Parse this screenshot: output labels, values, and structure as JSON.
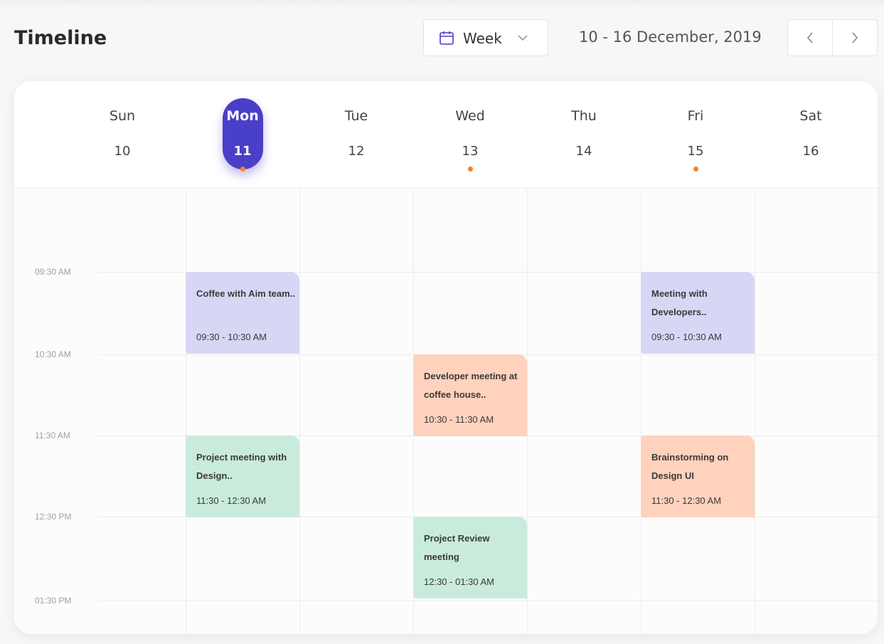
{
  "header": {
    "title": "Timeline",
    "view": "Week",
    "date_range": "10 - 16 December, 2019"
  },
  "days": [
    {
      "name": "Sun",
      "num": "10",
      "has_event": false,
      "selected": false
    },
    {
      "name": "Mon",
      "num": "11",
      "has_event": true,
      "selected": true
    },
    {
      "name": "Tue",
      "num": "12",
      "has_event": false,
      "selected": false
    },
    {
      "name": "Wed",
      "num": "13",
      "has_event": true,
      "selected": false
    },
    {
      "name": "Thu",
      "num": "14",
      "has_event": false,
      "selected": false
    },
    {
      "name": "Fri",
      "num": "15",
      "has_event": true,
      "selected": false
    },
    {
      "name": "Sat",
      "num": "16",
      "has_event": false,
      "selected": false
    }
  ],
  "times": [
    "09:30 AM",
    "10:30 AM",
    "11:30 AM",
    "12:30 PM",
    "01:30 PM"
  ],
  "events": [
    {
      "title": "Coffee with Aim team..",
      "time": "09:30 - 10:30 AM",
      "day": "Mon",
      "color": "#d8d6f5"
    },
    {
      "title": "Meeting with Developers..",
      "time": "09:30 - 10:30 AM",
      "day": "Fri",
      "color": "#d8d6f5"
    },
    {
      "title": "Developer meeting at coffee house..",
      "time": "10:30 - 11:30 AM",
      "day": "Wed",
      "color": "#fed2bd"
    },
    {
      "title": "Project meeting with Design..",
      "time": "11:30 - 12:30 AM",
      "day": "Mon",
      "color": "#c9ebdc"
    },
    {
      "title": "Brainstorming on Design UI",
      "time": "11:30 - 12:30 AM",
      "day": "Fri",
      "color": "#fed2bd"
    },
    {
      "title": "Project Review meeting",
      "time": "12:30 - 01:30 AM",
      "day": "Wed",
      "color": "#c9ebdc"
    }
  ],
  "colors": {
    "accent": "#4a3fc9",
    "dot": "#f08427"
  }
}
